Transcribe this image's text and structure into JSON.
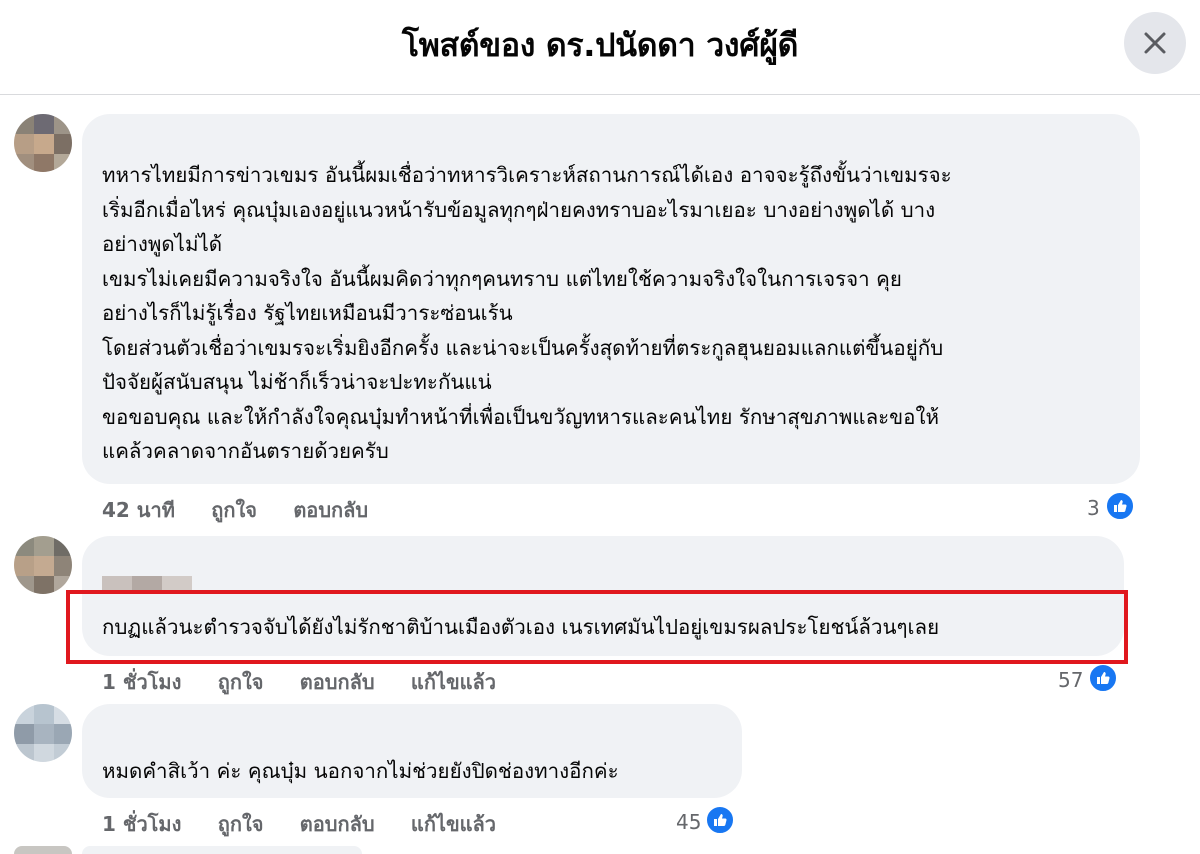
{
  "header": {
    "title": "โพสต์ของ ดร.ปนัดดา วงศ์ผู้ดี",
    "close_icon": "close-icon"
  },
  "comments": [
    {
      "author": "",
      "lines": [
        "ทหารไทยมีการข่าวเขมร อันนี้ผมเชื่อว่าทหารวิเคราะห์สถานการณ์ได้เอง อาจจะรู้ถึงขั้นว่าเขมรจะ",
        "เริ่มอีกเมื่อไหร่ คุณบุ๋มเองอยู่แนวหน้ารับข้อมูลทุกๆฝ่ายคงทราบอะไรมาเยอะ บางอย่างพูดได้ บาง",
        "อย่างพูดไม่ได้",
        "เขมรไม่เคยมีความจริงใจ อันนี้ผมคิดว่าทุกๆคนทราบ แต่ไทยใช้ความจริงใจในการเจรจา คุย",
        "อย่างไรก็ไม่รู้เรื่อง รัฐไทยเหมือนมีวาระซ่อนเร้น",
        "โดยส่วนตัวเชื่อว่าเขมรจะเริ่มยิงอีกครั้ง และน่าจะเป็นครั้งสุดท้ายที่ตระกูลฮุนยอมแลกแต่ขึ้นอยู่กับ",
        "ปัจจัยผู้สนับสนุน ไม่ช้าก็เร็วน่าจะปะทะกันแน่",
        "ขอขอบคุณ และให้กำลังใจคุณบุ๋มทำหน้าที่เพื่อเป็นขวัญทหารและคนไทย รักษาสุขภาพและขอให้",
        "แคล้วคลาดจากอันตรายด้วยครับ"
      ],
      "time": "42 นาที",
      "like_label": "ถูกใจ",
      "reply_label": "ตอบกลับ",
      "edited_label": "",
      "reactions": "3"
    },
    {
      "author": "",
      "lines": [
        "กบฏแล้วนะตำรวจจับได้ยังไม่รักชาติบ้านเมืองตัวเอง เนรเทศมันไปอยู่เขมรผลประโยชน์ล้วนๆเลย"
      ],
      "time": "1 ชั่วโมง",
      "like_label": "ถูกใจ",
      "reply_label": "ตอบกลับ",
      "edited_label": "แก้ไขแล้ว",
      "reactions": "57"
    },
    {
      "author": "",
      "lines": [
        "หมดคำสิเว้า ค่ะ คุณบุ๋ม นอกจากไม่ช่วยยังปิดช่องทางอีกค่ะ"
      ],
      "time": "1 ชั่วโมง",
      "like_label": "ถูกใจ",
      "reply_label": "ตอบกลับ",
      "edited_label": "แก้ไขแล้ว",
      "reactions": "45"
    }
  ],
  "colors": {
    "bubble": "#f0f2f5",
    "meta_text": "#65676b",
    "like_blue": "#1877f2",
    "highlight": "#e0181e"
  }
}
